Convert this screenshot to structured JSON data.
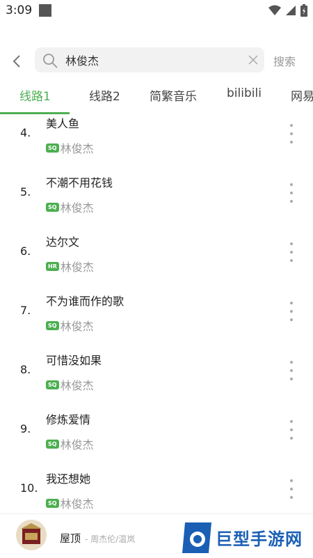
{
  "status_bar": {
    "time": "3:09"
  },
  "search": {
    "back_icon": "chevron-left-icon",
    "query": "林俊杰",
    "action_label": "搜索"
  },
  "tabs": [
    {
      "label": "线路1",
      "active": true
    },
    {
      "label": "线路2",
      "active": false
    },
    {
      "label": "简繁音乐",
      "active": false
    },
    {
      "label": "bilibili",
      "active": false
    },
    {
      "label": "网易",
      "active": false
    }
  ],
  "results": [
    {
      "rank": "4.",
      "title": "美人鱼",
      "quality": "SQ",
      "artist": "林俊杰"
    },
    {
      "rank": "5.",
      "title": "不潮不用花钱",
      "quality": "SQ",
      "artist": "林俊杰"
    },
    {
      "rank": "6.",
      "title": "达尔文",
      "quality": "HR",
      "artist": "林俊杰"
    },
    {
      "rank": "7.",
      "title": "不为谁而作的歌",
      "quality": "SQ",
      "artist": "林俊杰"
    },
    {
      "rank": "8.",
      "title": "可惜没如果",
      "quality": "SQ",
      "artist": "林俊杰"
    },
    {
      "rank": "9.",
      "title": "修炼爱情",
      "quality": "SQ",
      "artist": "林俊杰"
    },
    {
      "rank": "10.",
      "title": "我还想她",
      "quality": "SQ",
      "artist": "林俊杰"
    }
  ],
  "now_playing": {
    "title": "屋顶",
    "artist": "- 周杰伦/温岚"
  },
  "watermark": {
    "text": "巨型手游网"
  },
  "colors": {
    "accent": "#4caf50",
    "muted": "#999999",
    "watermark": "#1a5fb4"
  }
}
